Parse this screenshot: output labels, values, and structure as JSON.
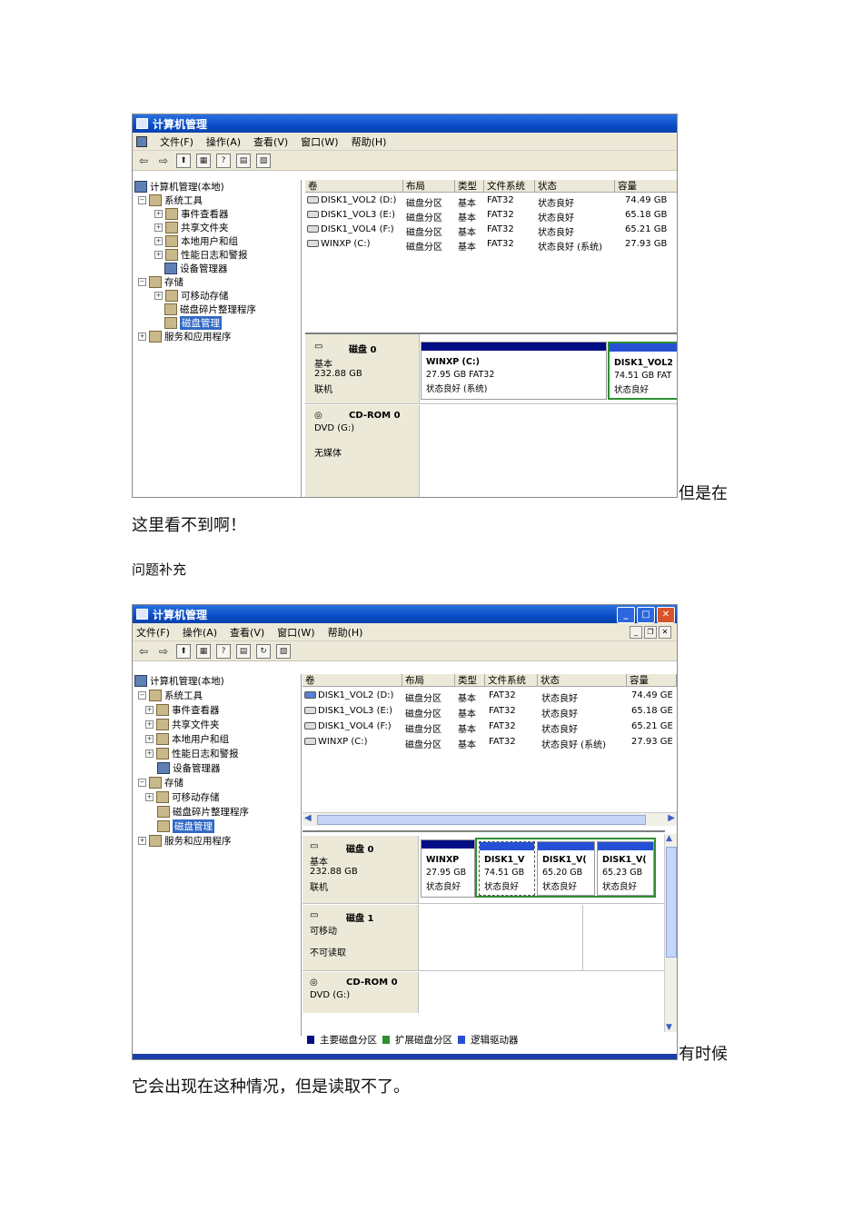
{
  "texts": {
    "caption1_end": "但是在",
    "caption1_next": "这里看不到啊！",
    "supplement": "问题补充",
    "caption2_end": "有时候",
    "caption2_next": "它会出现在这种情况，但是读取不了。"
  },
  "colors": {
    "primary_partition": "#000d84",
    "extended_partition": "#2f8f2f",
    "logical_drive": "#2650d4",
    "titlebar": "#0a4cc7",
    "selection": "#316ac5"
  },
  "window1": {
    "title": "计算机管理",
    "menu": [
      "文件(F)",
      "操作(A)",
      "查看(V)",
      "窗口(W)",
      "帮助(H)"
    ],
    "tree": [
      {
        "label": "计算机管理(本地)",
        "icon": "computer-icon"
      },
      {
        "label": "系统工具",
        "icon": "tools-icon"
      },
      {
        "label": "事件查看器",
        "icon": "event-viewer-icon"
      },
      {
        "label": "共享文件夹",
        "icon": "shared-folder-icon"
      },
      {
        "label": "本地用户和组",
        "icon": "users-icon"
      },
      {
        "label": "性能日志和警报",
        "icon": "performance-icon"
      },
      {
        "label": "设备管理器",
        "icon": "device-manager-icon"
      },
      {
        "label": "存储",
        "icon": "storage-icon"
      },
      {
        "label": "可移动存储",
        "icon": "removable-storage-icon"
      },
      {
        "label": "磁盘碎片整理程序",
        "icon": "defrag-icon"
      },
      {
        "label": "磁盘管理",
        "icon": "disk-management-icon"
      },
      {
        "label": "服务和应用程序",
        "icon": "services-icon"
      }
    ],
    "columns": [
      "卷",
      "布局",
      "类型",
      "文件系统",
      "状态",
      "容量"
    ],
    "volumes": [
      {
        "vol": "DISK1_VOL2 (D:)",
        "layout": "磁盘分区",
        "type": "基本",
        "fs": "FAT32",
        "status": "状态良好",
        "cap": "74.49 GB"
      },
      {
        "vol": "DISK1_VOL3 (E:)",
        "layout": "磁盘分区",
        "type": "基本",
        "fs": "FAT32",
        "status": "状态良好",
        "cap": "65.18 GB"
      },
      {
        "vol": "DISK1_VOL4 (F:)",
        "layout": "磁盘分区",
        "type": "基本",
        "fs": "FAT32",
        "status": "状态良好",
        "cap": "65.21 GB"
      },
      {
        "vol": "WINXP (C:)",
        "layout": "磁盘分区",
        "type": "基本",
        "fs": "FAT32",
        "status": "状态良好 (系统)",
        "cap": "27.93 GB"
      }
    ],
    "disk0": {
      "name": "磁盘 0",
      "kind": "基本",
      "size": "232.88 GB",
      "state": "联机",
      "partitions": [
        {
          "name": "WINXP (C:)",
          "size": "27.95 GB FAT32",
          "status": "状态良好 (系统)"
        },
        {
          "name": "DISK1_VOL2",
          "size": "74.51 GB FAT",
          "status": "状态良好"
        }
      ]
    },
    "cdrom": {
      "name": "CD-ROM 0",
      "drive": "DVD (G:)",
      "media": "无媒体"
    }
  },
  "window2": {
    "title": "计算机管理",
    "menu": [
      "文件(F)",
      "操作(A)",
      "查看(V)",
      "窗口(W)",
      "帮助(H)"
    ],
    "tree": [
      {
        "label": "计算机管理(本地)",
        "icon": "computer-icon"
      },
      {
        "label": "系统工具",
        "icon": "tools-icon"
      },
      {
        "label": "事件查看器",
        "icon": "event-viewer-icon"
      },
      {
        "label": "共享文件夹",
        "icon": "shared-folder-icon"
      },
      {
        "label": "本地用户和组",
        "icon": "users-icon"
      },
      {
        "label": "性能日志和警报",
        "icon": "performance-icon"
      },
      {
        "label": "设备管理器",
        "icon": "device-manager-icon"
      },
      {
        "label": "存储",
        "icon": "storage-icon"
      },
      {
        "label": "可移动存储",
        "icon": "removable-storage-icon"
      },
      {
        "label": "磁盘碎片整理程序",
        "icon": "defrag-icon"
      },
      {
        "label": "磁盘管理",
        "icon": "disk-management-icon"
      },
      {
        "label": "服务和应用程序",
        "icon": "services-icon"
      }
    ],
    "columns": [
      "卷",
      "布局",
      "类型",
      "文件系统",
      "状态",
      "容量"
    ],
    "volumes": [
      {
        "vol": "DISK1_VOL2 (D:)",
        "layout": "磁盘分区",
        "type": "基本",
        "fs": "FAT32",
        "status": "状态良好",
        "cap": "74.49 GE"
      },
      {
        "vol": "DISK1_VOL3 (E:)",
        "layout": "磁盘分区",
        "type": "基本",
        "fs": "FAT32",
        "status": "状态良好",
        "cap": "65.18 GE"
      },
      {
        "vol": "DISK1_VOL4 (F:)",
        "layout": "磁盘分区",
        "type": "基本",
        "fs": "FAT32",
        "status": "状态良好",
        "cap": "65.21 GE"
      },
      {
        "vol": "WINXP (C:)",
        "layout": "磁盘分区",
        "type": "基本",
        "fs": "FAT32",
        "status": "状态良好 (系统)",
        "cap": "27.93 GE"
      }
    ],
    "disk0": {
      "name": "磁盘 0",
      "kind": "基本",
      "size": "232.88 GB",
      "state": "联机",
      "partitions": [
        {
          "name": "WINXP",
          "size": "27.95 GB",
          "status": "状态良好"
        },
        {
          "name": "DISK1_V",
          "size": "74.51 GB",
          "status": "状态良好"
        },
        {
          "name": "DISK1_V(",
          "size": "65.20 GB",
          "status": "状态良好"
        },
        {
          "name": "DISK1_V(",
          "size": "65.23 GB",
          "status": "状态良好"
        }
      ]
    },
    "disk1": {
      "name": "磁盘 1",
      "kind": "可移动",
      "state": "不可读取"
    },
    "cdrom": {
      "name": "CD-ROM 0",
      "drive": "DVD (G:)"
    },
    "legend": [
      "主要磁盘分区",
      "扩展磁盘分区",
      "逻辑驱动器"
    ]
  }
}
